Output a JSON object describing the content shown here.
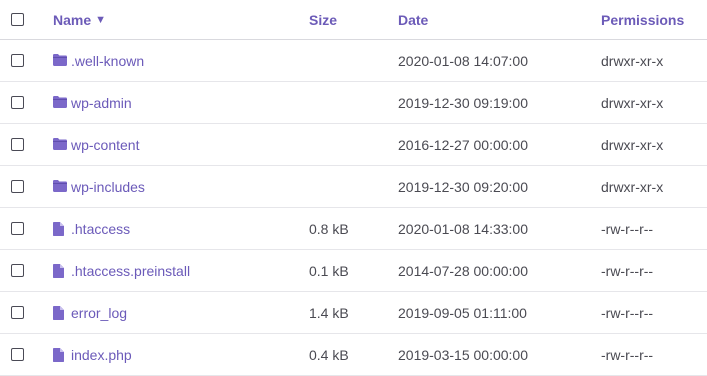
{
  "header": {
    "name_label": "Name",
    "sort_indicator": "▼",
    "size_label": "Size",
    "date_label": "Date",
    "permissions_label": "Permissions"
  },
  "colors": {
    "accent": "#6b5ab9",
    "text": "#4a4a52",
    "divider": "#e6e6ea"
  },
  "rows": [
    {
      "type": "folder",
      "icon": "folder-icon",
      "name": ".well-known",
      "size": "",
      "date": "2020-01-08 14:07:00",
      "permissions": "drwxr-xr-x"
    },
    {
      "type": "folder",
      "icon": "folder-icon",
      "name": "wp-admin",
      "size": "",
      "date": "2019-12-30 09:19:00",
      "permissions": "drwxr-xr-x"
    },
    {
      "type": "folder",
      "icon": "folder-icon",
      "name": "wp-content",
      "size": "",
      "date": "2016-12-27 00:00:00",
      "permissions": "drwxr-xr-x"
    },
    {
      "type": "folder",
      "icon": "folder-icon",
      "name": "wp-includes",
      "size": "",
      "date": "2019-12-30 09:20:00",
      "permissions": "drwxr-xr-x"
    },
    {
      "type": "file",
      "icon": "file-icon",
      "name": ".htaccess",
      "size": "0.8 kB",
      "date": "2020-01-08 14:33:00",
      "permissions": "-rw-r--r--"
    },
    {
      "type": "file",
      "icon": "file-icon",
      "name": ".htaccess.preinstall",
      "size": "0.1 kB",
      "date": "2014-07-28 00:00:00",
      "permissions": "-rw-r--r--"
    },
    {
      "type": "file",
      "icon": "file-icon",
      "name": "error_log",
      "size": "1.4 kB",
      "date": "2019-09-05 01:11:00",
      "permissions": "-rw-r--r--"
    },
    {
      "type": "file",
      "icon": "file-icon",
      "name": "index.php",
      "size": "0.4 kB",
      "date": "2019-03-15 00:00:00",
      "permissions": "-rw-r--r--"
    }
  ]
}
